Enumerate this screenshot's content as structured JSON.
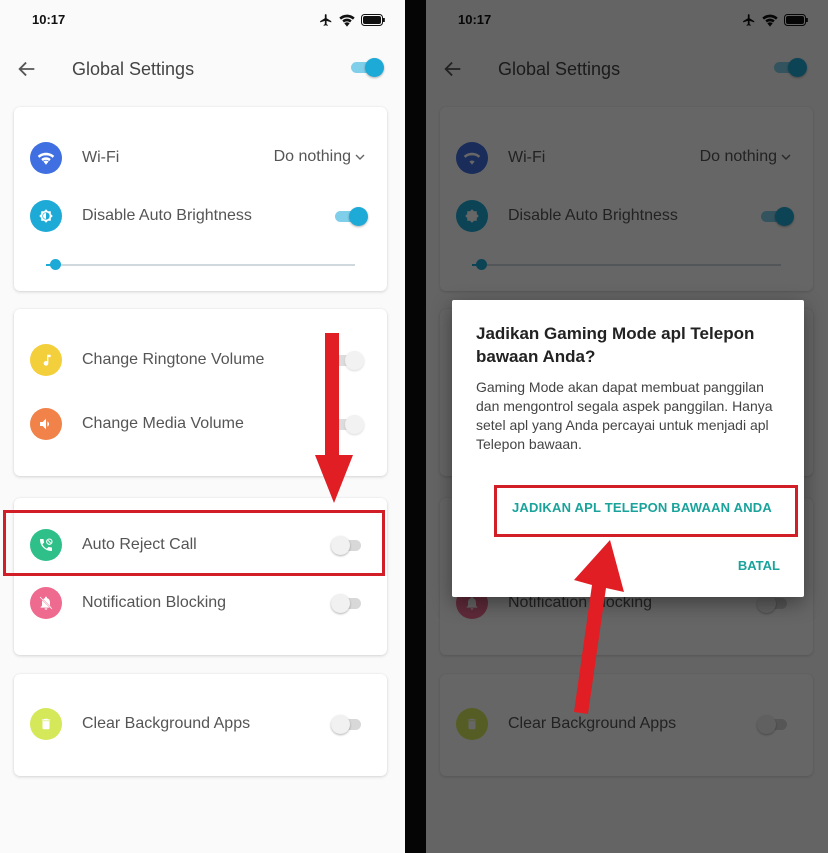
{
  "status": {
    "time": "10:17"
  },
  "header": {
    "title": "Global Settings"
  },
  "settings": {
    "wifi": {
      "label": "Wi-Fi",
      "action": "Do nothing"
    },
    "brightness": {
      "label": "Disable Auto Brightness",
      "level": 0.03
    },
    "ringtone": {
      "label": "Change Ringtone Volume"
    },
    "media": {
      "label": "Change Media Volume"
    },
    "reject": {
      "label": "Auto Reject Call"
    },
    "notif": {
      "label": "Notification Blocking"
    },
    "clear": {
      "label": "Clear Background Apps"
    }
  },
  "dialog": {
    "title": "Jadikan Gaming Mode apl Telepon bawaan Anda?",
    "body": "Gaming Mode akan dapat membuat panggilan dan mengontrol segala aspek panggilan. Hanya setel apl yang Anda percayai untuk menjadi apl Telepon bawaan.",
    "confirm": "JADIKAN APL TELEPON BAWAAN ANDA",
    "cancel": "BATAL"
  },
  "colors": {
    "accent": "#1eaad6",
    "wifi_icon": "#3f6fe0",
    "brightness_icon": "#1eaad6",
    "ringtone_icon": "#f4cf3c",
    "media_icon": "#f0824a",
    "reject_icon": "#2fc08a",
    "notif_icon": "#ee6a8e",
    "clear_icon": "#d5e85a",
    "highlight": "#d21f27",
    "dialog_button": "#1aa39b"
  },
  "icons": [
    "back-arrow-icon",
    "airplane-icon",
    "wifi-status-icon",
    "battery-icon",
    "wifi-icon",
    "brightness-icon",
    "music-note-icon",
    "speaker-icon",
    "phone-reject-icon",
    "bell-off-icon",
    "trash-icon",
    "chevron-down-icon"
  ]
}
